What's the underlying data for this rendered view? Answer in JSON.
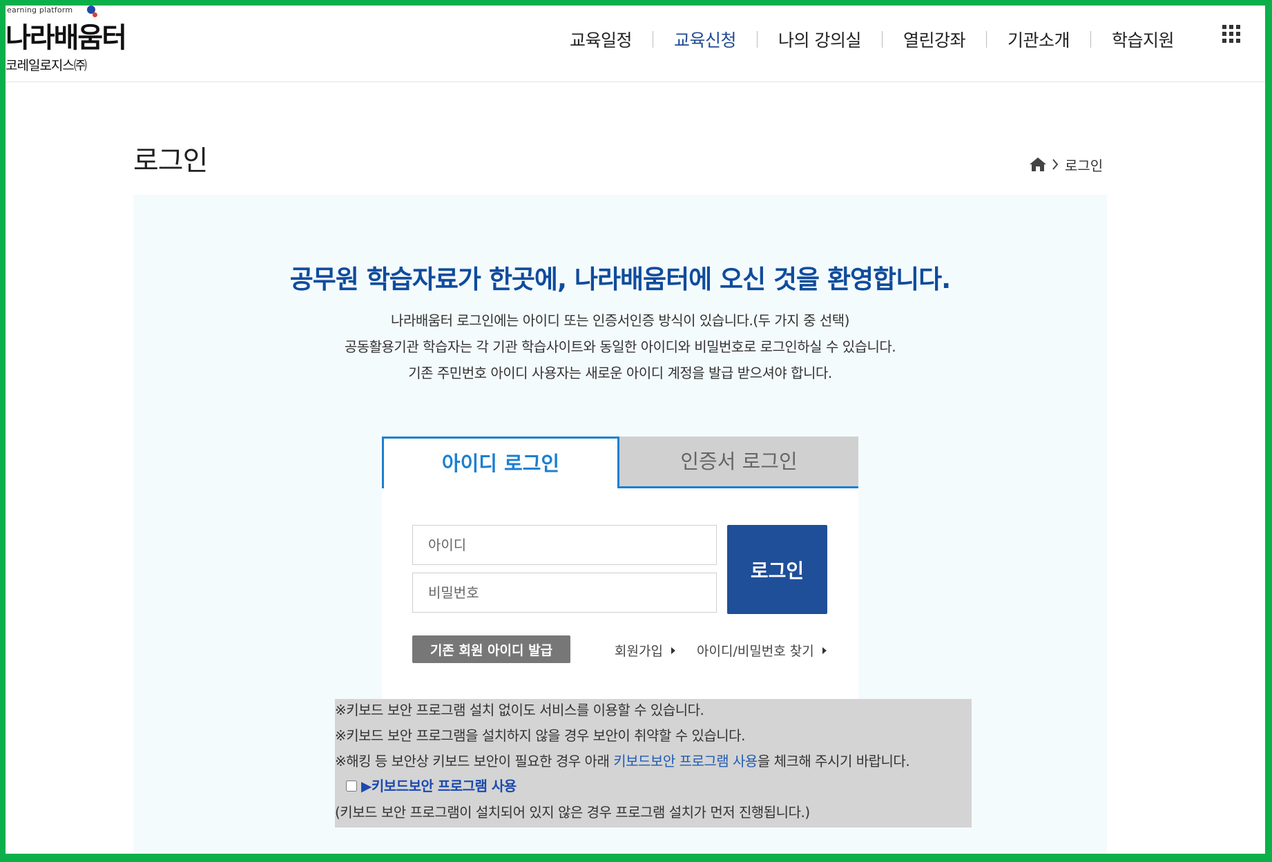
{
  "header": {
    "logo_tagline": "earning platform",
    "logo_title": "나라배움터",
    "logo_subtitle": "코레일로지스㈜",
    "nav": [
      {
        "label": "교육일정",
        "active": false
      },
      {
        "label": "교육신청",
        "active": true
      },
      {
        "label": "나의 강의실",
        "active": false
      },
      {
        "label": "열린강좌",
        "active": false
      },
      {
        "label": "기관소개",
        "active": false
      },
      {
        "label": "학습지원",
        "active": false
      }
    ],
    "menu_icon": "grid-menu-icon"
  },
  "page": {
    "title": "로그인",
    "breadcrumb_current": "로그인"
  },
  "welcome": {
    "heading": "공무원 학습자료가 한곳에, 나라배움터에 오신 것을 환영합니다.",
    "lines": [
      "나라배움터 로그인에는 아이디 또는 인증서인증 방식이 있습니다.(두 가지 중 선택)",
      "공동활용기관 학습자는 각 기관 학습사이트와 동일한 아이디와 비밀번호로 로그인하실 수 있습니다.",
      "기존 주민번호 아이디 사용자는 새로운 아이디 계정을 발급 받으셔야 합니다."
    ]
  },
  "login": {
    "tab_id": "아이디 로그인",
    "tab_cert": "인증서 로그인",
    "id_placeholder": "아이디",
    "pw_placeholder": "비밀번호",
    "login_button": "로그인",
    "issue_button": "기존 회원 아이디 발급",
    "join_link": "회원가입",
    "find_link": "아이디/비밀번호 찾기"
  },
  "notice": {
    "line1": "※키보드 보안 프로그램 설치 없이도 서비스를 이용할 수 있습니다.",
    "line2": "※키보드 보안 프로그램을 설치하지 않을 경우 보안이 취약할 수 있습니다.",
    "line3_prefix": "※해킹 등 보안상 키보드 보안이 필요한 경우 아래 ",
    "line3_highlight": "키보드보안 프로그램 사용",
    "line3_suffix": "을 체크해 주시기 바랍니다.",
    "checkbox_label": "▶키보드보안 프로그램 사용",
    "line5": "(키보드 보안 프로그램이 설치되어 있지 않은 경우 프로그램 설치가 먼저 진행됩니다.)"
  },
  "colors": {
    "frame": "#0cb04a",
    "accent_blue": "#1b7fd0",
    "heading_blue": "#0f4c9c",
    "login_button": "#1f4f99",
    "panel_bg": "#f4fbfd"
  }
}
